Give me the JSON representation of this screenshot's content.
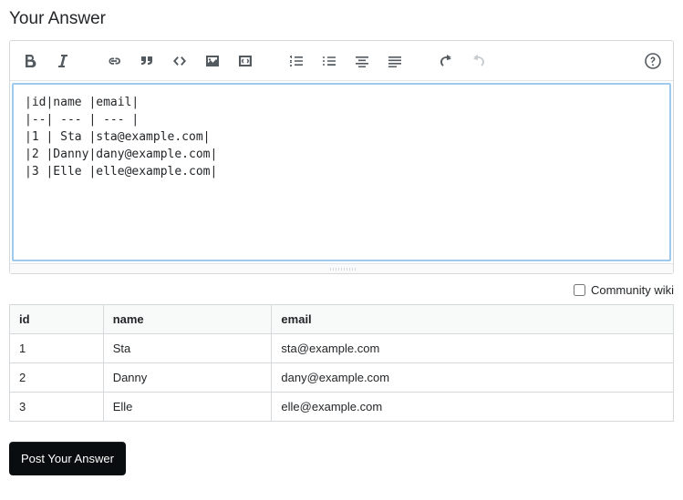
{
  "heading": "Your Answer",
  "editor": {
    "content": "|id|name |email|\n|--| --- | --- |\n|1 | Sta |sta@example.com|\n|2 |Danny|dany@example.com|\n|3 |Elle |elle@example.com|"
  },
  "community_wiki": {
    "label": "Community wiki",
    "checked": false
  },
  "preview": {
    "columns": [
      "id",
      "name",
      "email"
    ],
    "rows": [
      [
        "1",
        "Sta",
        "sta@example.com"
      ],
      [
        "2",
        "Danny",
        "dany@example.com"
      ],
      [
        "3",
        "Elle",
        "elle@example.com"
      ]
    ]
  },
  "post_button": "Post Your Answer",
  "chart_data": {
    "type": "table",
    "columns": [
      "id",
      "name",
      "email"
    ],
    "rows": [
      [
        "1",
        "Sta",
        "sta@example.com"
      ],
      [
        "2",
        "Danny",
        "dany@example.com"
      ],
      [
        "3",
        "Elle",
        "elle@example.com"
      ]
    ]
  }
}
